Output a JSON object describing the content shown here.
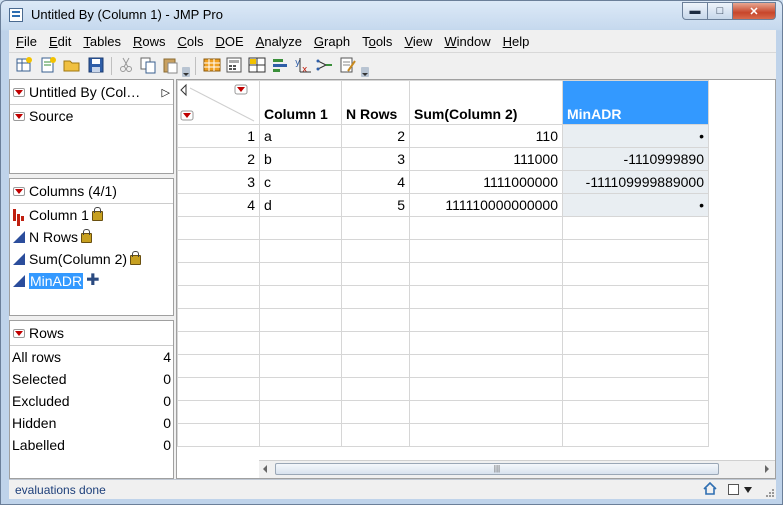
{
  "window": {
    "title": "Untitled By (Column 1) - JMP Pro"
  },
  "menus": [
    "File",
    "Edit",
    "Tables",
    "Rows",
    "Cols",
    "DOE",
    "Analyze",
    "Graph",
    "Tools",
    "View",
    "Window",
    "Help"
  ],
  "menu_underline": [
    "F",
    "E",
    "T",
    "R",
    "C",
    "D",
    "A",
    "G",
    "o",
    "V",
    "W",
    "H"
  ],
  "left_panel": {
    "table_name": "Untitled By (Col…",
    "source_label": "Source",
    "columns_header": "Columns (4/1)",
    "columns": [
      {
        "name": "Column 1",
        "type": "nominal",
        "locked": true
      },
      {
        "name": "N Rows",
        "type": "continuous",
        "locked": true
      },
      {
        "name": "Sum(Column 2)",
        "type": "continuous",
        "locked": true
      },
      {
        "name": "MinADR",
        "type": "continuous",
        "locked": false,
        "selected": true
      }
    ],
    "rows_header": "Rows",
    "rows_stats": [
      {
        "label": "All rows",
        "value": "4"
      },
      {
        "label": "Selected",
        "value": "0"
      },
      {
        "label": "Excluded",
        "value": "0"
      },
      {
        "label": "Hidden",
        "value": "0"
      },
      {
        "label": "Labelled",
        "value": "0"
      }
    ]
  },
  "table": {
    "headers": [
      "Column 1",
      "N Rows",
      "Sum(Column 2)",
      "MinADR"
    ],
    "rows": [
      {
        "n": "1",
        "cells": [
          "a",
          "2",
          "110",
          "•"
        ]
      },
      {
        "n": "2",
        "cells": [
          "b",
          "3",
          "111000",
          "-1110999890"
        ]
      },
      {
        "n": "3",
        "cells": [
          "c",
          "4",
          "1111000000",
          "-111109999889000"
        ]
      },
      {
        "n": "4",
        "cells": [
          "d",
          "5",
          "111110000000000",
          "•"
        ]
      }
    ]
  },
  "status": {
    "text": "evaluations done"
  },
  "colors": {
    "selection": "#3399ff",
    "nominal": "#c02010",
    "continuous": "#2b4d9c"
  }
}
